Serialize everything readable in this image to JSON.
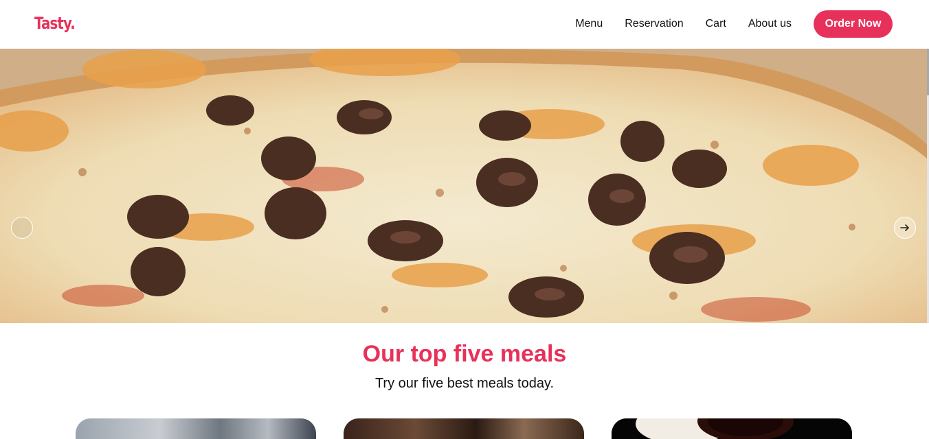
{
  "header": {
    "logo": "Tasty.",
    "nav": [
      "Menu",
      "Reservation",
      "Cart",
      "About us"
    ],
    "cta": "Order Now"
  },
  "hero": {
    "image": "pizza-photo",
    "prev_icon": "arrow-left-icon",
    "next_icon": "arrow-right-icon"
  },
  "meals": {
    "title": "Our top five meals",
    "subtitle": "Try our five best meals today."
  },
  "colors": {
    "accent": "#e8315a",
    "text": "#111111",
    "background": "#ffffff"
  }
}
